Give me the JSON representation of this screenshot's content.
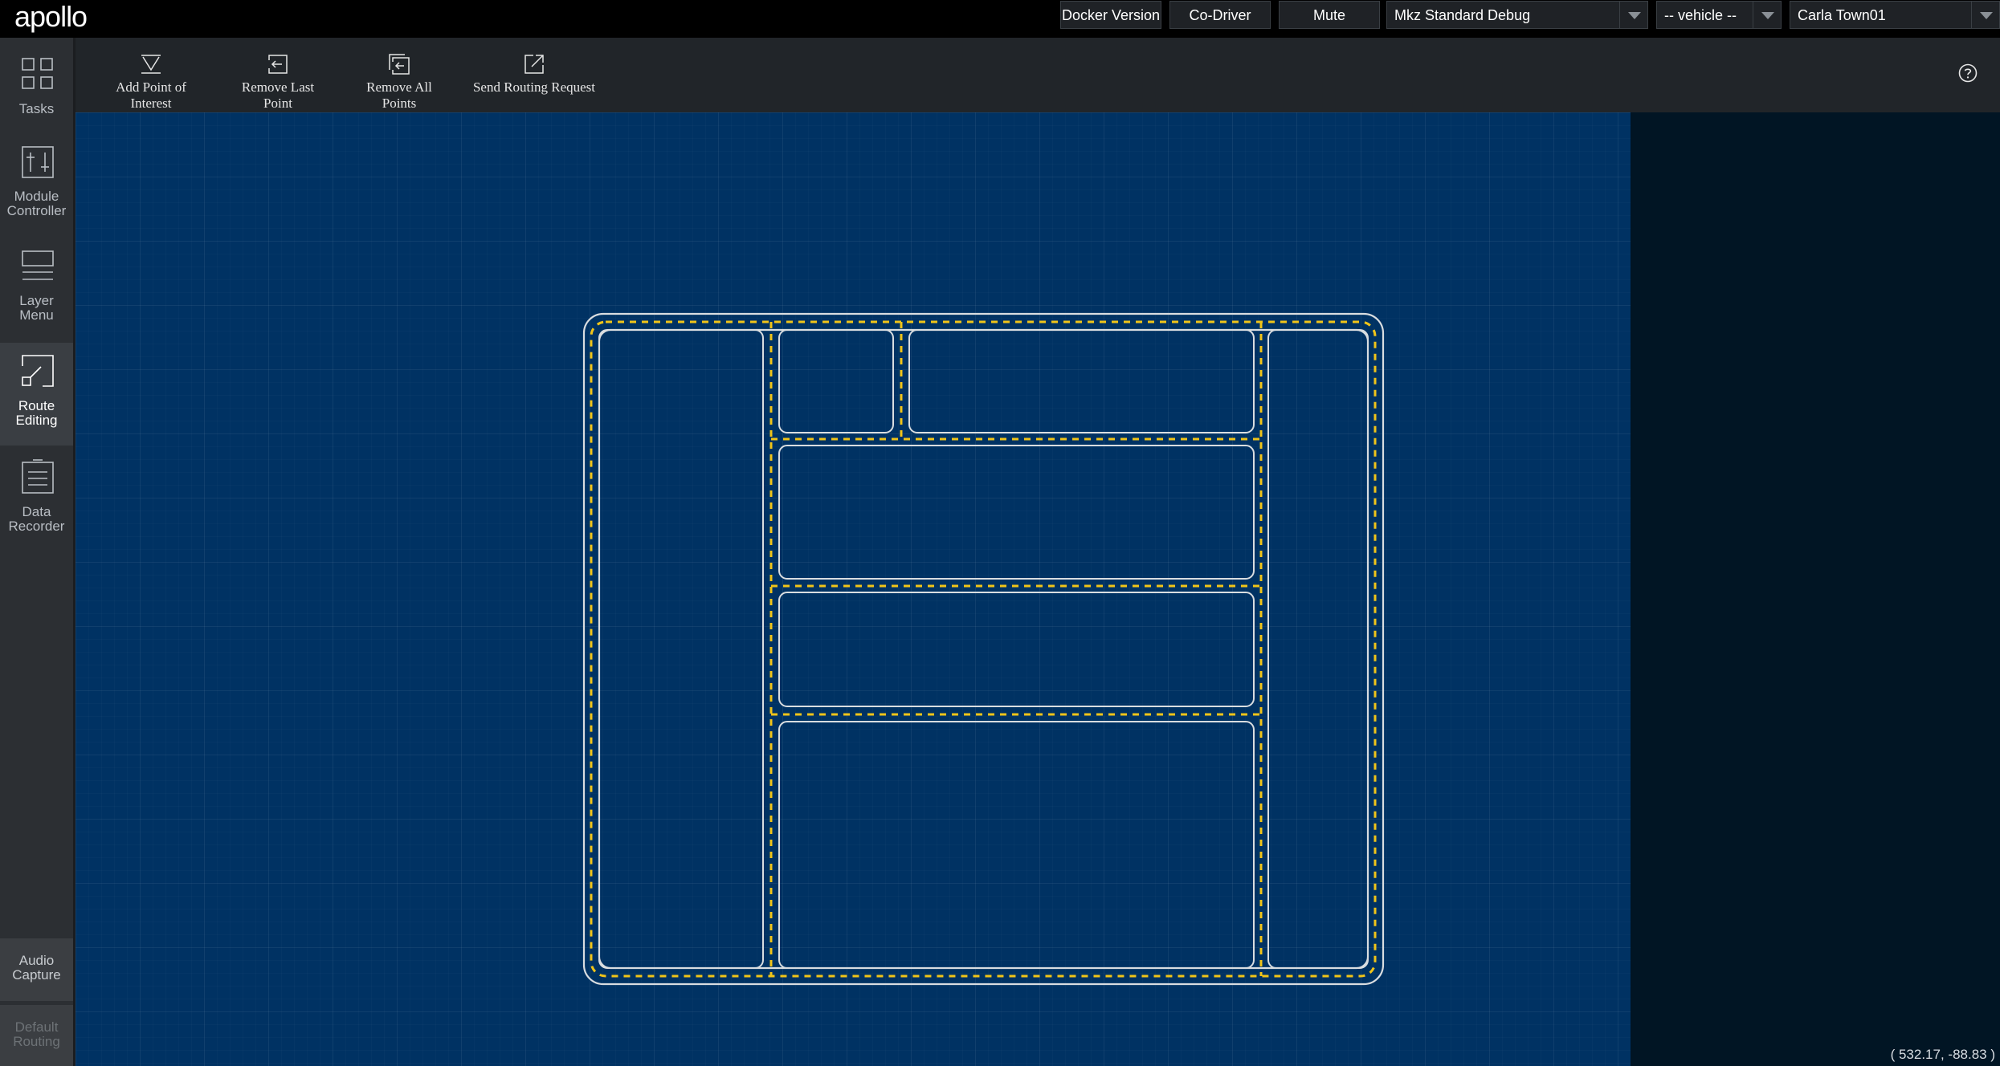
{
  "app": {
    "logo_text": "apollo"
  },
  "header": {
    "docker_version_label": "Docker Version",
    "co_driver_label": "Co-Driver",
    "mute_label": "Mute",
    "mode_select_value": "Mkz Standard Debug",
    "vehicle_select_value": "-- vehicle --",
    "map_select_value": "Carla Town01"
  },
  "sidebar": {
    "items": [
      {
        "label_line1": "Tasks",
        "label_line2": "",
        "icon": "grid-icon"
      },
      {
        "label_line1": "Module",
        "label_line2": "Controller",
        "icon": "module-controller-icon"
      },
      {
        "label_line1": "Layer",
        "label_line2": "Menu",
        "icon": "layer-menu-icon"
      },
      {
        "label_line1": "Route",
        "label_line2": "Editing",
        "icon": "route-editing-icon"
      },
      {
        "label_line1": "Data",
        "label_line2": "Recorder",
        "icon": "data-recorder-icon"
      }
    ],
    "audio_capture_line1": "Audio",
    "audio_capture_line2": "Capture",
    "default_routing_line1": "Default",
    "default_routing_line2": "Routing",
    "active_item": "Route Editing"
  },
  "toolbar": {
    "add_point_label": "Add Point of Interest",
    "remove_last_label": "Remove Last Point",
    "remove_all_label": "Remove All Points",
    "send_routing_label": "Send Routing Request",
    "help_icon": "help-circle-icon"
  },
  "map": {
    "cursor_coordinates": "( 532.17, -88.83 )",
    "colors": {
      "background": "#003263",
      "lane_border": "#d9dde0",
      "center_line": "#f0c419"
    }
  }
}
